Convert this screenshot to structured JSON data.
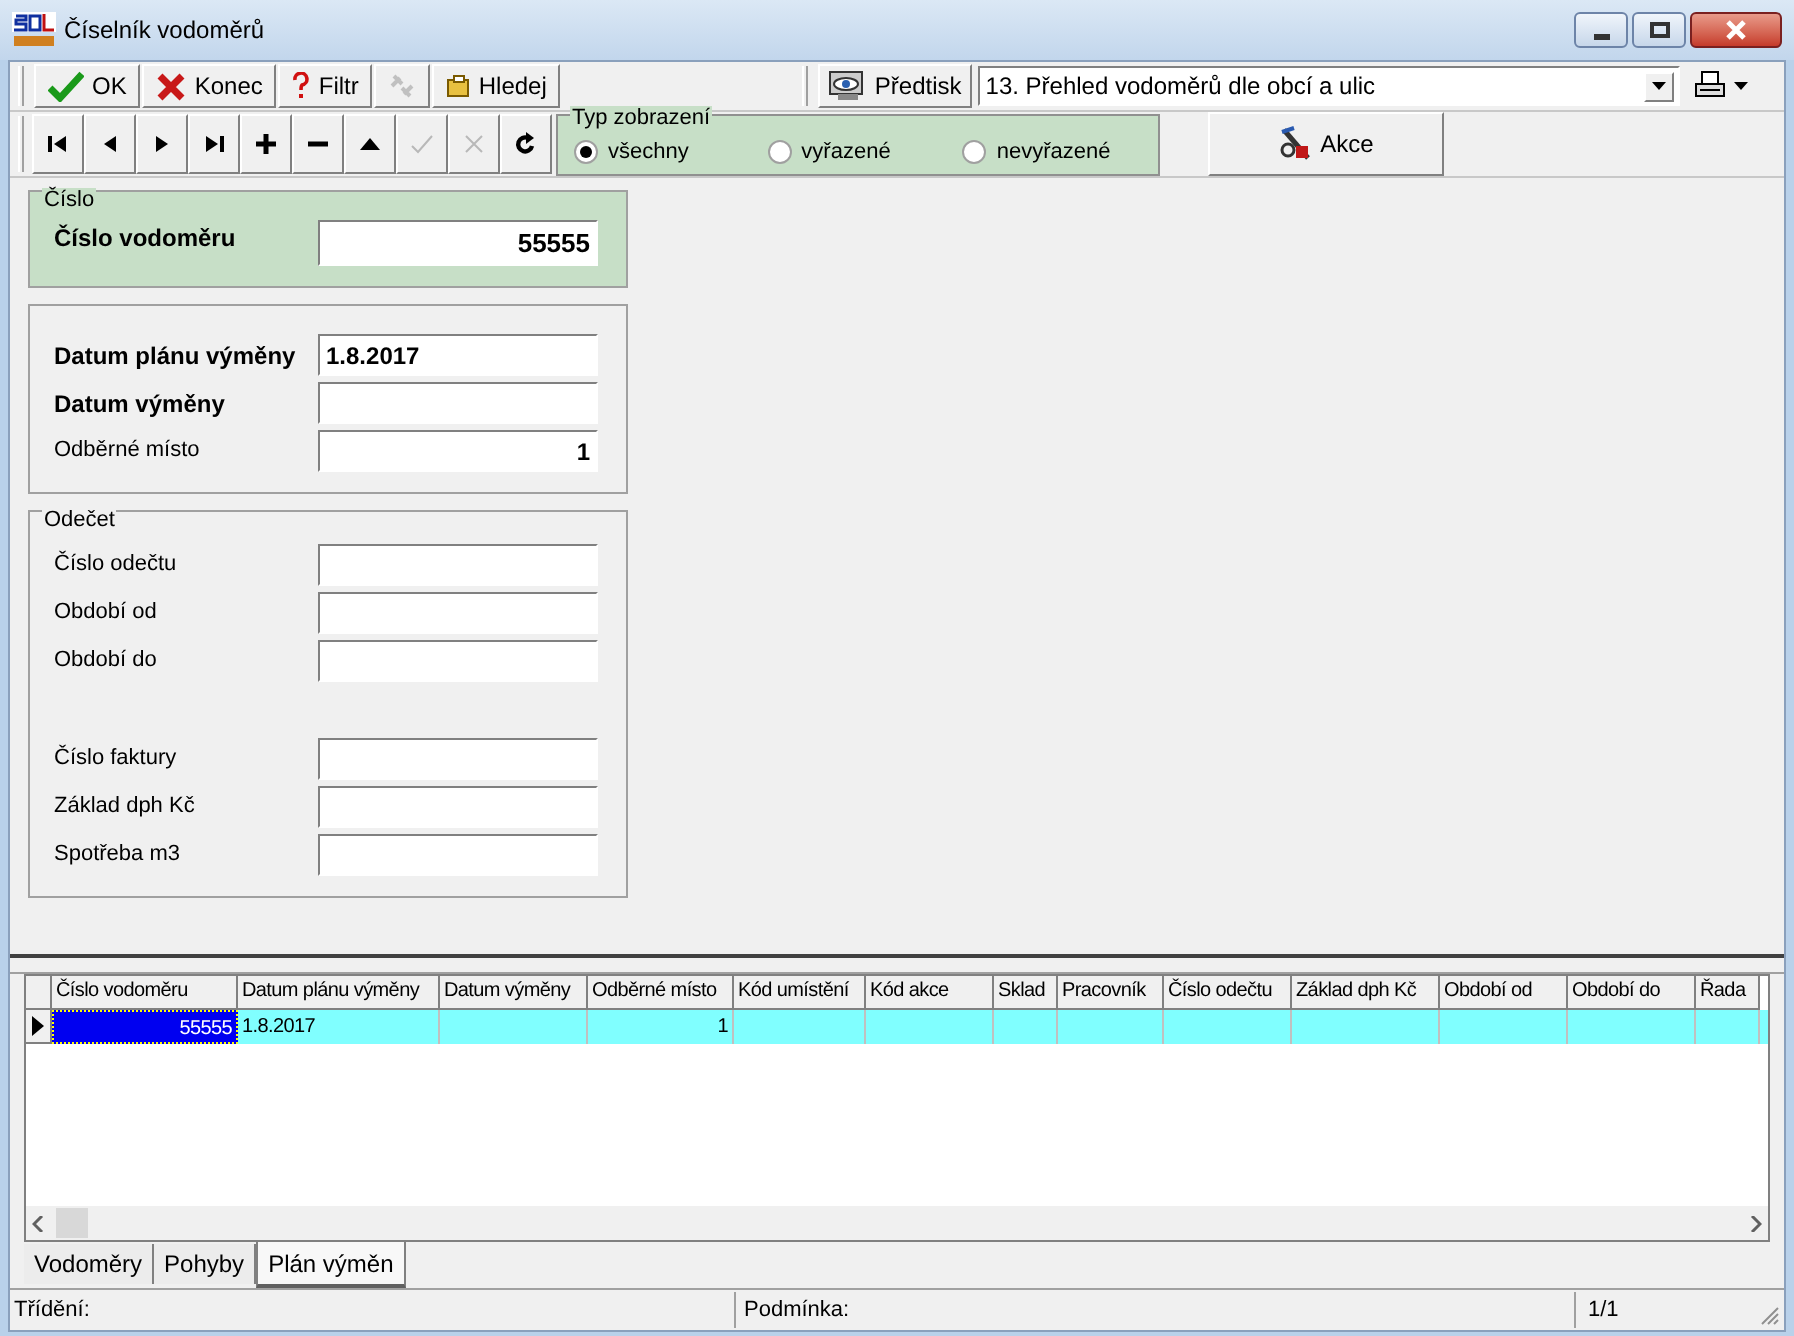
{
  "window": {
    "title": "Číselník vodoměrů"
  },
  "toolbar": [
    {
      "kind": "ok",
      "label": "OK",
      "disabled": false
    },
    {
      "kind": "close",
      "label": "Konec",
      "disabled": false
    },
    {
      "kind": "filter",
      "label": "Filtr",
      "disabled": false
    },
    {
      "kind": "link",
      "disabled": true
    },
    {
      "kind": "search",
      "label": "Hledej",
      "disabled": false
    }
  ],
  "pretisk": {
    "label": "Předtisk",
    "report": "13. Přehled vodoměrů dle obcí a ulic"
  },
  "nav": [
    {
      "kind": "first",
      "disabled": false
    },
    {
      "kind": "prev",
      "disabled": false
    },
    {
      "kind": "next",
      "disabled": false
    },
    {
      "kind": "last",
      "disabled": false
    },
    {
      "kind": "add",
      "disabled": false
    },
    {
      "kind": "remove",
      "disabled": false
    },
    {
      "kind": "up",
      "disabled": false
    },
    {
      "kind": "confirm",
      "disabled": true
    },
    {
      "kind": "cancel",
      "disabled": true
    },
    {
      "kind": "refresh",
      "disabled": false
    }
  ],
  "view_type": {
    "title": "Typ zobrazení",
    "options": [
      {
        "label": "všechny",
        "selected": true
      },
      {
        "label": "vyřazené",
        "selected": false
      },
      {
        "label": "nevyřazené",
        "selected": false
      }
    ]
  },
  "action_button": {
    "label": "Akce"
  },
  "groups": [
    {
      "title": "Číslo",
      "highlighted": true,
      "sections": [
        {
          "fields": [
            {
              "label": "Číslo vodoměru",
              "bold": true,
              "value": "55555",
              "kind": "number"
            }
          ]
        }
      ]
    },
    {
      "highlighted": false,
      "sections": [
        {
          "fields": [
            {
              "label": "Datum plánu výměny",
              "bold": true,
              "value": "1.8.2017",
              "kind": "date"
            },
            {
              "label": "Datum výměny",
              "bold": true,
              "kind": "date"
            },
            {
              "label": "Odběrné místo",
              "bold": false,
              "value": "1",
              "kind": "number"
            }
          ]
        }
      ]
    },
    {
      "title": "Odečet",
      "highlighted": false,
      "sections": [
        {
          "fields": [
            {
              "label": "Číslo odečtu",
              "bold": false,
              "kind": "text"
            },
            {
              "label": "Období od",
              "bold": false,
              "kind": "date"
            },
            {
              "label": "Období do",
              "bold": false,
              "kind": "date"
            }
          ]
        },
        {
          "fields": [
            {
              "label": "Číslo faktury",
              "bold": false,
              "kind": "text"
            },
            {
              "label": "Základ dph Kč",
              "bold": false,
              "kind": "number"
            },
            {
              "label": "Spotřeba m3",
              "bold": false,
              "kind": "number"
            }
          ]
        }
      ]
    }
  ],
  "table": {
    "columns": [
      "Číslo vodoměru",
      "Datum plánu výměny",
      "Datum výměny",
      "Odběrné místo",
      "Kód umístění",
      "Kód akce",
      "Sklad",
      "Pracovník",
      "Číslo odečtu",
      "Základ dph Kč",
      "Období od",
      "Období do",
      "Řada"
    ],
    "rows": [
      {
        "selected": true,
        "cells": [
          "55555",
          "1.8.2017",
          "",
          "1",
          "",
          "",
          "",
          "",
          "",
          "",
          "",
          "",
          ""
        ]
      }
    ]
  },
  "tabs": [
    {
      "label": "Vodoměry",
      "selected": false
    },
    {
      "label": "Pohyby",
      "selected": false
    },
    {
      "label": "Plán výměn",
      "selected": true
    }
  ],
  "status_bar": {
    "sorting": "Třídění:",
    "condition": "Podmínka:",
    "position": "1/1"
  }
}
